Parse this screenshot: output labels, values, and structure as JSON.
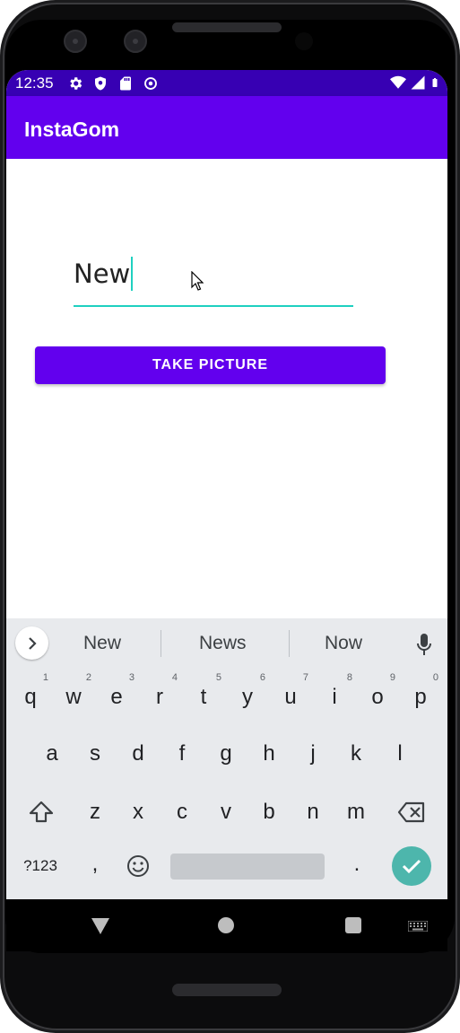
{
  "status_bar": {
    "time": "12:35",
    "left_icons": [
      "settings-icon",
      "shield-icon",
      "sd-card-icon",
      "sync-icon"
    ],
    "right_icons": [
      "wifi-icon",
      "signal-icon",
      "battery-icon"
    ],
    "color": "#3700b3"
  },
  "app_bar": {
    "title": "InstaGom",
    "color": "#6200ee"
  },
  "form": {
    "input_value": "New",
    "button_label": "TAKE PICTURE",
    "accent": "#1fd0c0"
  },
  "keyboard": {
    "suggestions": [
      "New",
      "News",
      "Now"
    ],
    "row1": [
      {
        "key": "q",
        "hint": "1"
      },
      {
        "key": "w",
        "hint": "2"
      },
      {
        "key": "e",
        "hint": "3"
      },
      {
        "key": "r",
        "hint": "4"
      },
      {
        "key": "t",
        "hint": "5"
      },
      {
        "key": "y",
        "hint": "6"
      },
      {
        "key": "u",
        "hint": "7"
      },
      {
        "key": "i",
        "hint": "8"
      },
      {
        "key": "o",
        "hint": "9"
      },
      {
        "key": "p",
        "hint": "0"
      }
    ],
    "row2": [
      "a",
      "s",
      "d",
      "f",
      "g",
      "h",
      "j",
      "k",
      "l"
    ],
    "row3": [
      "z",
      "x",
      "c",
      "v",
      "b",
      "n",
      "m"
    ],
    "symbols_label": "?123",
    "comma": ",",
    "period": ".",
    "enter_color": "#4db6ac"
  }
}
